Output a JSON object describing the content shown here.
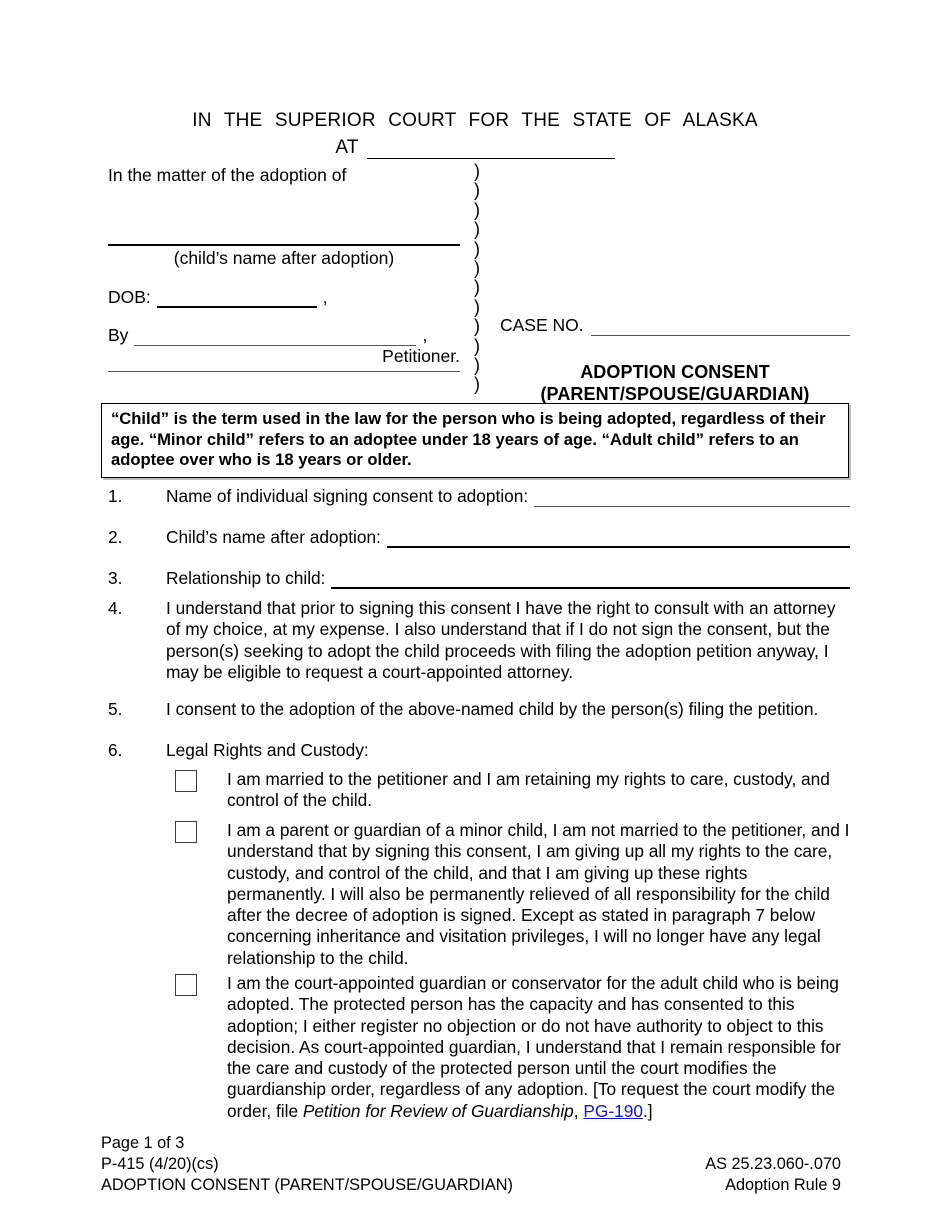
{
  "header": {
    "court_line": "IN THE SUPERIOR COURT FOR THE STATE OF ALASKA",
    "at_label": "AT"
  },
  "caption": {
    "matter_line": "In the matter of the adoption of",
    "child_name_caption": "(child’s name after adoption)",
    "dob_label": "DOB:",
    "dob_comma": ",",
    "by_label": "By",
    "by_comma": ",",
    "petitioner_label": "Petitioner.",
    "case_no_label": "CASE NO.",
    "doc_title_line1": "ADOPTION CONSENT",
    "doc_title_line2": "(PARENT/SPOUSE/GUARDIAN)",
    "parens": ")\n)\n)\n)\n)\n)\n)\n)\n)\n)\n)\n)"
  },
  "notice": {
    "text": "“Child” is the term used in the law for the person who is being adopted, regardless of their age.  “Minor child” refers to an adoptee under 18 years of age.  “Adult child” refers to an adoptee over who is 18 years or older."
  },
  "items": {
    "n1": "1.",
    "t1": "Name of individual signing consent to adoption:",
    "n2": "2.",
    "t2": "Child’s name after adoption:",
    "n3": "3.",
    "t3": "Relationship to child:",
    "n4": "4.",
    "t4": "I understand that prior to signing this consent I have the right to consult with an attorney of my choice, at my expense.  I also understand that if I do not sign the consent, but the person(s) seeking to adopt the child proceeds with filing the adoption petition anyway, I may be eligible to request a court-appointed attorney.",
    "n5": "5.",
    "t5": "I consent to the adoption of the above-named child by the person(s) filing the petition.",
    "n6": "6.",
    "t6": "Legal Rights and Custody:"
  },
  "checkboxes": {
    "cb1": "I am married to the petitioner and I am retaining my rights to care, custody, and control of the child.",
    "cb2": "I am a parent or guardian of a minor child, I am not married to the petitioner, and I understand that by signing this consent, I am giving up all my rights to the care, custody, and control of the child, and that I am giving up these rights permanently.  I will also be permanently relieved of all responsibility for the child after the decree of adoption is signed.  Except as stated in paragraph 7 below concerning inheritance and visitation privileges, I will no longer have any legal relationship to the child.",
    "cb3_part1": "I am the court-appointed guardian or conservator for the adult child who is being adopted.  The protected person has the capacity and has consented to this adoption; I either register no objection or do not have authority to object to this decision.  As court-appointed guardian, I understand that I remain responsible for the care and custody of the protected person until the court modifies the guardianship order, regardless of any adoption.  [To request the court modify the order, file ",
    "cb3_italic": "Petition for Review of Guardianship",
    "cb3_comma": ", ",
    "cb3_link": "PG-190",
    "cb3_part2": ".]"
  },
  "footer": {
    "page_label": "Page 1 of 3",
    "form_number": "P-415 (4/20)(cs)",
    "form_title": "ADOPTION CONSENT (PARENT/SPOUSE/GUARDIAN)",
    "statute": "AS 25.23.060-.070",
    "rule": "Adoption Rule 9"
  },
  "colors": {
    "link": "#1414d2",
    "rule": "#555555",
    "text": "#000000"
  }
}
